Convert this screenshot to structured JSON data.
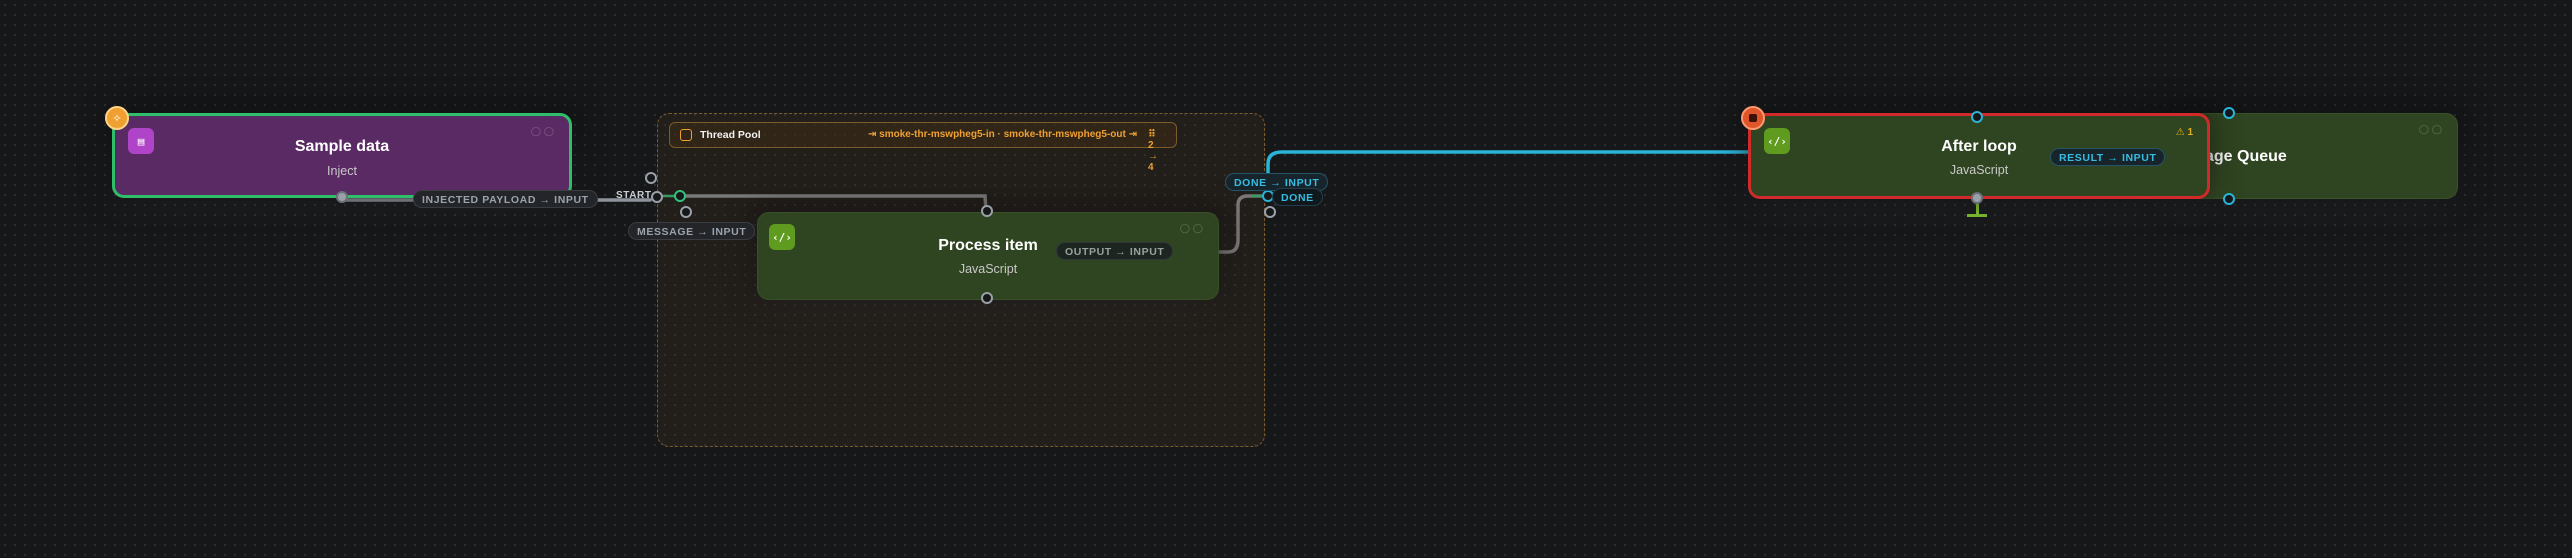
{
  "nodes": {
    "sample_data": {
      "title": "Sample data",
      "subtitle": "Inject",
      "icon": "file-icon",
      "color": "#5a2a64",
      "border": "#2fbf6a"
    },
    "process_item": {
      "title": "Process item",
      "subtitle": "JavaScript",
      "icon": "code-icon",
      "color": "#2f4420"
    },
    "after_loop": {
      "title": "After loop",
      "subtitle": "JavaScript",
      "icon": "code-icon",
      "color": "#2f4420",
      "border": "#d12a2a",
      "warning_count": "1"
    },
    "message_queue": {
      "title": "age Queue",
      "color": "#2f4420"
    }
  },
  "group": {
    "title": "Thread Pool",
    "route": "⇥ smoke-thr-mswpheg5-in · smoke-thr-mswpheg5-out ⇥",
    "count": "⠿ 2 → 4"
  },
  "edges": {
    "injected_payload": "INJECTED PAYLOAD → INPUT",
    "start": "START",
    "message": "MESSAGE → INPUT",
    "output": "OUTPUT → INPUT",
    "done_input": "DONE → INPUT",
    "done": "DONE",
    "result": "RESULT → INPUT"
  },
  "colors": {
    "wire_blue": "#2ab4d8",
    "wire_gray": "#9aa0a8",
    "wire_green": "#33c27a",
    "accent_orange": "#f0a030",
    "error_red": "#d12a2a"
  }
}
